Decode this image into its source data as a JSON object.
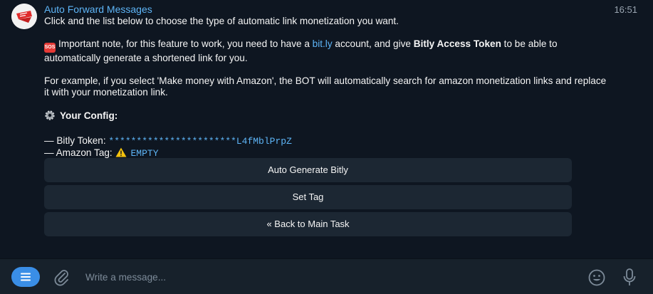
{
  "chat": {
    "sender": "Auto Forward Messages",
    "time": "16:51",
    "paragraphs": {
      "intro": "Click and the list below to choose the type of automatic link monetization you want.",
      "note_prefix": "Important note, for this feature to work, you need to have a ",
      "note_link": "bit.ly",
      "note_mid": " account, and give ",
      "note_bold": "Bitly Access Token",
      "note_suffix": " to be able to automatically generate a shortened link for you.",
      "example": "For example, if you select 'Make money with Amazon', the BOT will automatically search for amazon monetization links and replace it with your monetization link.",
      "config_title": "Your Config:",
      "token_label": "— Bitly Token: ",
      "token_value": "***********************L4fMblPrpZ",
      "tag_label": "— Amazon Tag: ",
      "tag_value": "EMPTY"
    },
    "icons": {
      "sos": "sos-icon",
      "gear": "gear-icon",
      "warning": "warning-icon"
    },
    "sos_text": "SOS"
  },
  "keyboard": {
    "buttons": [
      "Auto Generate Bitly",
      "Set Tag",
      "« Back to Main Task"
    ]
  },
  "composer": {
    "placeholder": "Write a message..."
  },
  "colors": {
    "background": "#0e1621",
    "accent": "#5eb5f7",
    "button": "#1c2733",
    "composer": "#17212b"
  }
}
